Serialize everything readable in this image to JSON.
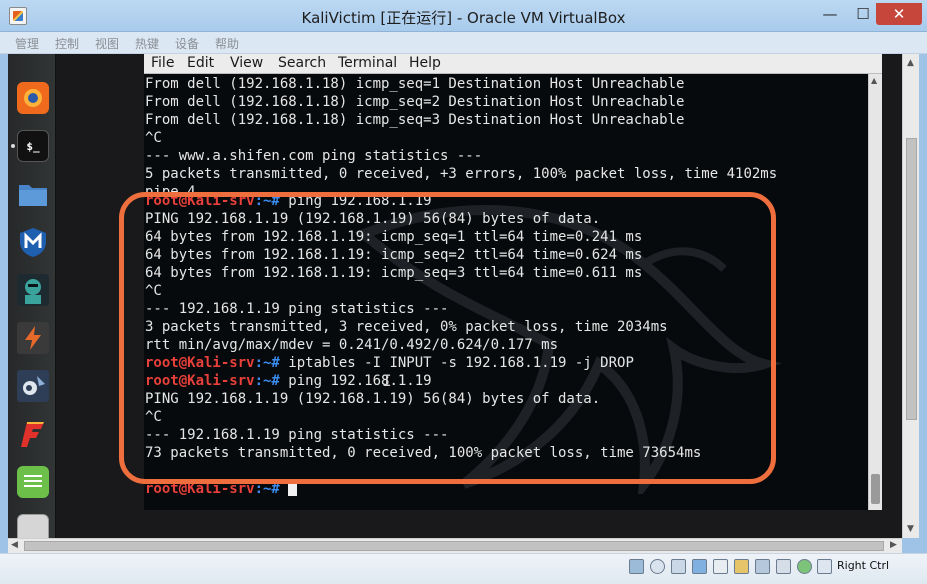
{
  "window": {
    "title": "KaliVictim [正在运行] - Oracle VM VirtualBox",
    "minimize": "—",
    "maximize": "☐",
    "close": "✕"
  },
  "menubar": [
    "管理",
    "控制",
    "视图",
    "热键",
    "设备",
    "帮助"
  ],
  "dock": {
    "items": [
      {
        "name": "firefox-icon",
        "glyph": "",
        "color": "#f06a1d"
      },
      {
        "name": "terminal-icon",
        "glyph": "$_",
        "color": "#2b2b2b"
      },
      {
        "name": "files-icon",
        "glyph": "",
        "color": "#4a84c8"
      },
      {
        "name": "metasploit-icon",
        "glyph": "M",
        "color": "#1f5fb0"
      },
      {
        "name": "armitage-icon",
        "glyph": "",
        "color": "#3aa39b"
      },
      {
        "name": "burpsuite-icon",
        "glyph": "⚡",
        "color": "#e86a2a"
      },
      {
        "name": "beef-icon",
        "glyph": "",
        "color": "#2e3e56"
      },
      {
        "name": "faraday-icon",
        "glyph": "F",
        "color": "#d93025"
      },
      {
        "name": "leafpad-icon",
        "glyph": "≡",
        "color": "#6cc04a"
      },
      {
        "name": "show-apps-icon",
        "glyph": "⠿",
        "color": "#cfcfcf"
      }
    ]
  },
  "terminal": {
    "menu": [
      "File",
      "Edit",
      "View",
      "Search",
      "Terminal",
      "Help"
    ],
    "prompt_user": "root@Kali-srv",
    "prompt_path": ":~#",
    "lines": [
      {
        "text": "From dell (192.168.1.18) icmp_seq=1 Destination Host Unreachable"
      },
      {
        "text": "From dell (192.168.1.18) icmp_seq=2 Destination Host Unreachable"
      },
      {
        "text": "From dell (192.168.1.18) icmp_seq=3 Destination Host Unreachable"
      },
      {
        "text": "^C"
      },
      {
        "text": "--- www.a.shifen.com ping statistics ---"
      },
      {
        "text": "5 packets transmitted, 0 received, +3 errors, 100% packet loss, time 4102ms"
      },
      {
        "text": "pipe 4",
        "partial": true
      },
      {
        "prompt": true,
        "text": " ping 192.168.1.19"
      },
      {
        "text": "PING 192.168.1.19 (192.168.1.19) 56(84) bytes of data."
      },
      {
        "text": "64 bytes from 192.168.1.19: icmp_seq=1 ttl=64 time=0.241 ms"
      },
      {
        "text": "64 bytes from 192.168.1.19: icmp_seq=2 ttl=64 time=0.624 ms"
      },
      {
        "text": "64 bytes from 192.168.1.19: icmp_seq=3 ttl=64 time=0.611 ms"
      },
      {
        "text": "^C"
      },
      {
        "text": "--- 192.168.1.19 ping statistics ---"
      },
      {
        "text": "3 packets transmitted, 3 received, 0% packet loss, time 2034ms"
      },
      {
        "text": "rtt min/avg/max/mdev = 0.241/0.492/0.624/0.177 ms"
      },
      {
        "prompt": true,
        "text": " iptables -I INPUT -s 192.168.1.19 -j DROP"
      },
      {
        "prompt": true,
        "text": " ping 192.168.1.19"
      },
      {
        "text": "PING 192.168.1.19 (192.168.1.19) 56(84) bytes of data."
      },
      {
        "text": "^C"
      },
      {
        "text": "--- 192.168.1.19 ping statistics ---"
      },
      {
        "text": "73 packets transmitted, 0 received, 100% packet loss, time 73654ms"
      },
      {
        "text": ""
      },
      {
        "prompt": true,
        "text": " ",
        "cursor": true
      }
    ]
  },
  "annotation_color": "#ee6f3d",
  "statusbar": {
    "host_key": "Right Ctrl",
    "icons": [
      "hdd-icon",
      "optical-drive-icon",
      "audio-icon",
      "network-icon",
      "usb-icon",
      "shared-folders-icon",
      "display-icon",
      "video-capture-icon",
      "mouse-integration-icon",
      "keyboard-icon"
    ]
  }
}
